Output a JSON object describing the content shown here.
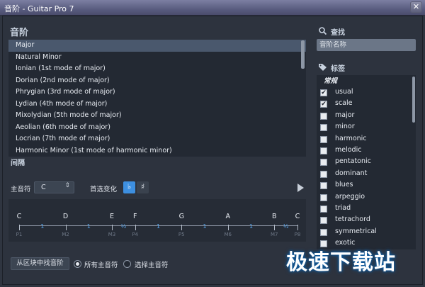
{
  "window": {
    "title": "音阶 - Guitar Pro 7",
    "close_glyph": "✕"
  },
  "scales": {
    "title": "音阶",
    "items": [
      "Major",
      "Natural Minor",
      "Ionian (1st mode of major)",
      "Dorian (2nd mode of major)",
      "Phrygian (3rd mode of major)",
      "Lydian (4th mode of major)",
      "Mixolydian (5th mode of major)",
      "Aeolian (6th mode of major)",
      "Locrian (7th mode of major)",
      "Harmonic Minor (1st mode of harmonic minor)"
    ],
    "selected": 0
  },
  "interval": {
    "title": "间隔",
    "root_label": "主音符",
    "root_value": "C",
    "combo_arrow": "⇕",
    "accidental_label": "首选变化",
    "flat": "♭",
    "sharp": "♯",
    "notes": [
      "C",
      "D",
      "E",
      "F",
      "G",
      "A",
      "B",
      "C"
    ],
    "steps": [
      "1",
      "1",
      "½",
      "1",
      "1",
      "1",
      "½"
    ],
    "intervals": [
      "P1",
      "M2",
      "M3",
      "P4",
      "P5",
      "M6",
      "M7",
      "P8"
    ]
  },
  "bottom": {
    "find_button": "从区块中找音阶",
    "radio_all": "所有主音符",
    "radio_select": "选择主音符"
  },
  "search": {
    "title": "查找",
    "placeholder": "音阶名称"
  },
  "tags": {
    "title": "标签",
    "header": "常规",
    "items": [
      {
        "label": "usual",
        "checked": true
      },
      {
        "label": "scale",
        "checked": true
      },
      {
        "label": "major",
        "checked": false
      },
      {
        "label": "minor",
        "checked": false
      },
      {
        "label": "harmonic",
        "checked": false
      },
      {
        "label": "melodic",
        "checked": false
      },
      {
        "label": "pentatonic",
        "checked": false
      },
      {
        "label": "dominant",
        "checked": false
      },
      {
        "label": "blues",
        "checked": false
      },
      {
        "label": "arpeggio",
        "checked": false
      },
      {
        "label": "triad",
        "checked": false
      },
      {
        "label": "tetrachord",
        "checked": false
      },
      {
        "label": "symmetrical",
        "checked": false
      },
      {
        "label": "exotic",
        "checked": false
      }
    ],
    "check_glyph": "✔"
  },
  "watermark": "极速下载站",
  "colors": {
    "accent": "#3d8fe0",
    "selection": "#4a586d",
    "step_text": "#59a7ee"
  }
}
